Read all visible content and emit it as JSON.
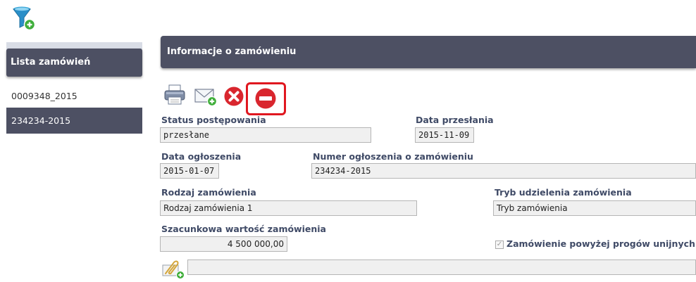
{
  "sidebar": {
    "title": "Lista zamówień",
    "items": [
      {
        "label": "0009348_2015"
      },
      {
        "label": "234234-2015"
      }
    ]
  },
  "main": {
    "title": "Informacje o zamówieniu"
  },
  "toolbar": {
    "icons": [
      "printer-icon",
      "envelope-add-icon",
      "delete-x-icon",
      "minus-circle-icon"
    ]
  },
  "form": {
    "status": {
      "label": "Status postępowania",
      "value": "przesłane"
    },
    "data_przeslania": {
      "label": "Data przesłania",
      "value": "2015-11-09"
    },
    "data_ogloszenia": {
      "label": "Data ogłoszenia",
      "value": "2015-01-07"
    },
    "numer_ogloszenia": {
      "label": "Numer ogłoszenia o zamówieniu",
      "value": "234234-2015"
    },
    "rodzaj": {
      "label": "Rodzaj zamówienia",
      "value": "Rodzaj zamówienia 1"
    },
    "tryb": {
      "label": "Tryb udzielenia zamówienia",
      "value": "Tryb zamówienia"
    },
    "wartosc": {
      "label": "Szacunkowa wartość zamówienia",
      "value": "4 500 000,00"
    },
    "progi": {
      "label": "Zamówienie powyżej progów unijnych",
      "checked": true
    },
    "attachment": {
      "value": ""
    }
  },
  "colors": {
    "header_bg": "#4d5063",
    "label_color": "#3f4a66",
    "highlight": "#e0171f",
    "delete_red": "#d9262e"
  }
}
